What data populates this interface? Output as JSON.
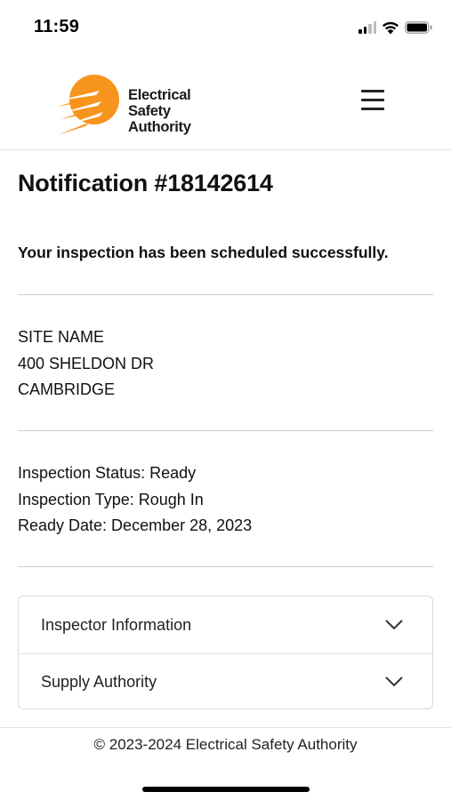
{
  "status_bar": {
    "time": "11:59",
    "icons": [
      "cellular-signal-icon",
      "wifi-icon",
      "battery-icon"
    ]
  },
  "header": {
    "logo": {
      "line1": "Electrical",
      "line2": "Safety",
      "line3": "Authority",
      "brand_color": "#f7941d"
    },
    "menu_icon": "hamburger-menu-icon"
  },
  "notification": {
    "title": "Notification #18142614",
    "success_message": "Your inspection has been scheduled successfully."
  },
  "site": {
    "name": "SITE NAME",
    "address": "400 SHELDON DR",
    "city": "CAMBRIDGE"
  },
  "inspection": {
    "status": "Inspection Status: Ready",
    "type": "Inspection Type: Rough In",
    "ready_date": "Ready Date: December 28, 2023"
  },
  "accordion": {
    "items": [
      {
        "label": "Inspector Information",
        "icon": "chevron-down-icon"
      },
      {
        "label": "Supply Authority",
        "icon": "chevron-down-icon"
      }
    ]
  },
  "footer": {
    "copyright": "© 2023-2024 Electrical Safety Authority"
  }
}
